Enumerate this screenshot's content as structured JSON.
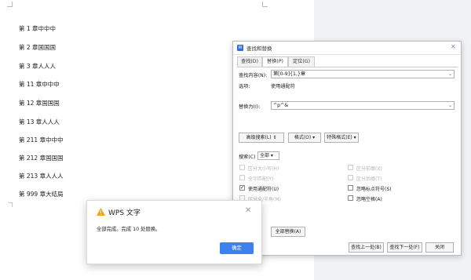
{
  "document": {
    "lines": [
      "第 1 章中中中",
      "第 2 章国国国",
      "第 3 章人人人",
      "第 11 章中中中",
      "第 12 章国国国",
      "第 13 章人人人",
      "第 211 章中中中",
      "第 212 章国国国",
      "第 213 章人人人",
      "第 999 章大结局"
    ]
  },
  "dialog": {
    "title": "查找和替换",
    "tabs": [
      "查找(D)",
      "替换(P)",
      "定位(G)"
    ],
    "active_tab": "替换(P)",
    "find_label": "查找内容(N):",
    "find_value": "第[0-9]{1,}章",
    "options_label": "选项:",
    "options_value": "使用通配符",
    "replace_label": "替换为(I):",
    "replace_value": "^p^&",
    "advanced_search_button": "高级搜索(L) ⇕",
    "format_button": "格式(O) ▾",
    "special_format_button": "特殊格式(E) ▾",
    "search_label": "搜索(C)",
    "search_scope": "全部",
    "options_left": [
      {
        "label": "区分大小写(H)",
        "checked": false,
        "enabled": false
      },
      {
        "label": "全字匹配(Y)",
        "checked": false,
        "enabled": false
      },
      {
        "label": "使用通配符(U)",
        "checked": true,
        "enabled": true
      },
      {
        "label": "区分全/半角(M)",
        "checked": false,
        "enabled": false
      }
    ],
    "options_right": [
      {
        "label": "区分前缀(X)",
        "checked": false,
        "enabled": false
      },
      {
        "label": "区分后缀(T)",
        "checked": false,
        "enabled": false
      },
      {
        "label": "忽略标点符号(S)",
        "checked": false,
        "enabled": true
      },
      {
        "label": "忽略空格(A)",
        "checked": false,
        "enabled": true
      }
    ],
    "replace_all_button": "全部替换(A)",
    "find_prev_button": "查找上一处(B)",
    "find_next_button": "查找下一处(F)",
    "close_button": "关闭"
  },
  "message_box": {
    "title": "WPS 文字",
    "text": "全部完成。完成 10 处替换。",
    "ok_button": "确定"
  },
  "colors": {
    "accent": "#3b82f0",
    "warning": "#f0a21b",
    "logo": "#2f6fd6"
  }
}
